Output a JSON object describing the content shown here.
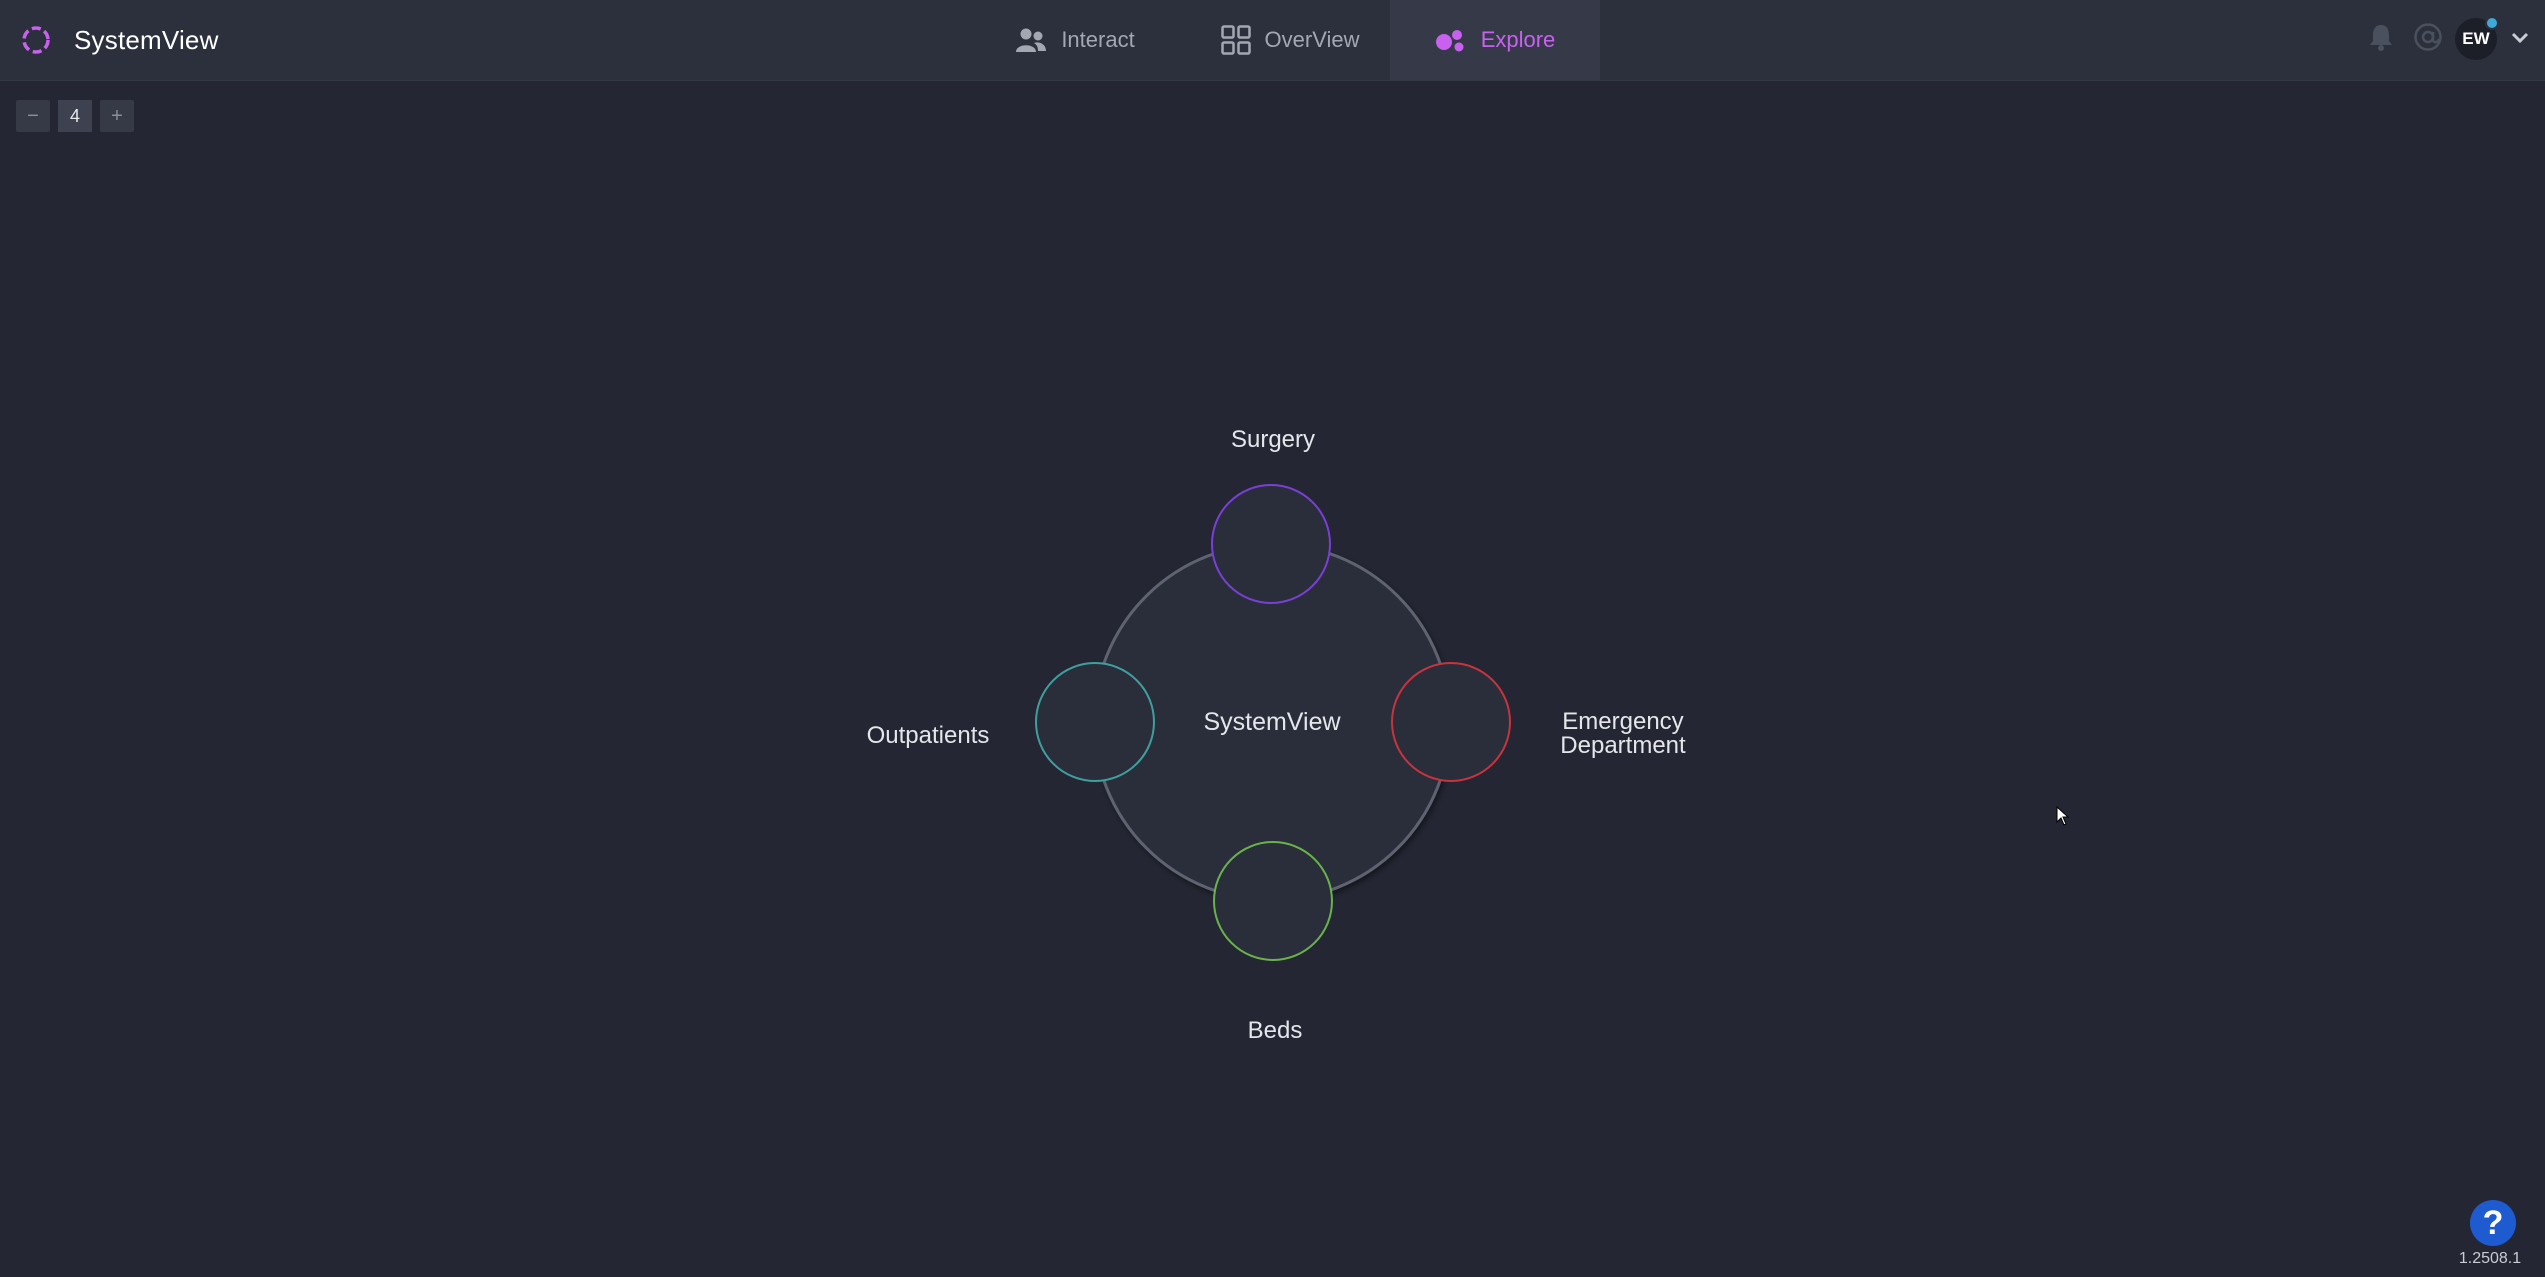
{
  "app": {
    "name": "SystemView",
    "version": "1.2508.1"
  },
  "nav": {
    "tabs": [
      {
        "label": "Interact",
        "icon": "people-icon",
        "active": false
      },
      {
        "label": "OverView",
        "icon": "grid-icon",
        "active": false
      },
      {
        "label": "Explore",
        "icon": "explore-icon",
        "active": true
      }
    ]
  },
  "user": {
    "initials": "EW"
  },
  "zoom": {
    "minus_label": "−",
    "value": "4",
    "plus_label": "+"
  },
  "diagram": {
    "center_label": "SystemView",
    "nodes": [
      {
        "label": "Surgery",
        "color": "#7a3fd6"
      },
      {
        "label": "Emergency Department",
        "color": "#c9333e"
      },
      {
        "label": "Beds",
        "color": "#69b34c"
      },
      {
        "label": "Outpatients",
        "color": "#3f9f9f"
      }
    ]
  },
  "help": {
    "label": "?"
  },
  "colors": {
    "background": "#242733",
    "topbar": "#2c303c",
    "accent": "#c861ef",
    "help": "#1f5bd0"
  }
}
